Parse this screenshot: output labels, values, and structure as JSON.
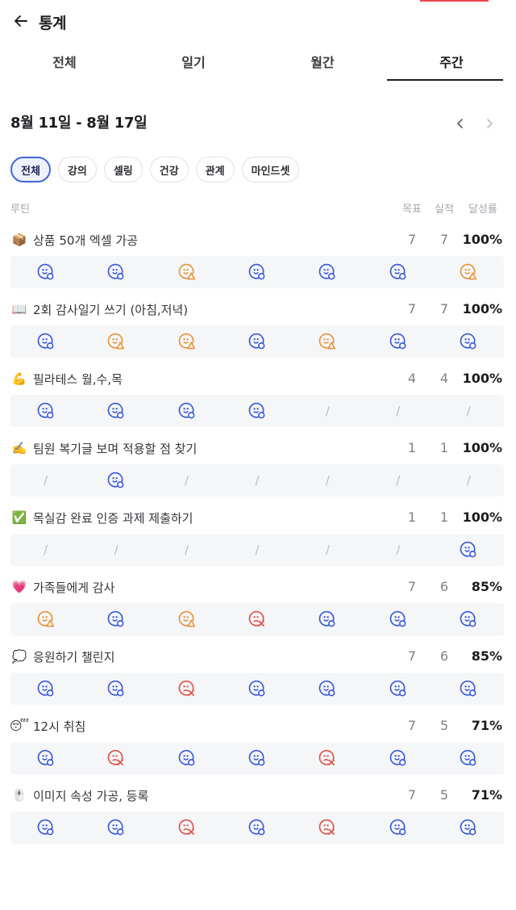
{
  "header": {
    "back_icon": "arrow-left-icon",
    "title": "통계"
  },
  "tabs": [
    {
      "label": "전체",
      "active": false
    },
    {
      "label": "일기",
      "active": false
    },
    {
      "label": "월간",
      "active": false
    },
    {
      "label": "주간",
      "active": true
    }
  ],
  "week": {
    "range_label": "8월 11일 - 8월 17일",
    "prev_icon": "chevron-left-icon",
    "next_icon": "chevron-right-icon"
  },
  "filters": [
    {
      "label": "전체",
      "active": true
    },
    {
      "label": "강의",
      "active": false
    },
    {
      "label": "셀링",
      "active": false
    },
    {
      "label": "건강",
      "active": false
    },
    {
      "label": "관계",
      "active": false
    },
    {
      "label": "마인드셋",
      "active": false
    }
  ],
  "columns": {
    "routine": "루틴",
    "goal": "목표",
    "actual": "실적",
    "rate": "달성률"
  },
  "colors": {
    "success": "#3a5ad9",
    "partial": "#e8933a",
    "fail": "#e0524b",
    "accent": "#4565d9",
    "top_accent": "#e5484d"
  },
  "routines": [
    {
      "icon": "package-emoji-icon",
      "emoji": "📦",
      "name": "상품 50개 엑셀 가공",
      "goal": "7",
      "actual": "7",
      "rate": "100%",
      "days": [
        "success",
        "success",
        "partial",
        "success",
        "success",
        "success",
        "partial"
      ]
    },
    {
      "icon": "open-book-emoji-icon",
      "emoji": "📖",
      "name": "2회 감사일기 쓰기 (아침,저녁)",
      "goal": "7",
      "actual": "7",
      "rate": "100%",
      "days": [
        "success",
        "partial",
        "partial",
        "success",
        "partial",
        "success",
        "success"
      ]
    },
    {
      "icon": "flexed-biceps-emoji-icon",
      "emoji": "💪",
      "name": "필라테스 월,수,목",
      "goal": "4",
      "actual": "4",
      "rate": "100%",
      "days": [
        "success",
        "success",
        "success",
        "success",
        "none",
        "none",
        "none"
      ]
    },
    {
      "icon": "writing-hand-emoji-icon",
      "emoji": "✍️",
      "name": "팀원 복기글 보며 적용할 점 찾기",
      "goal": "1",
      "actual": "1",
      "rate": "100%",
      "days": [
        "none",
        "success",
        "none",
        "none",
        "none",
        "none",
        "none"
      ]
    },
    {
      "icon": "check-mark-emoji-icon",
      "emoji": "✅",
      "name": "목실감 완료 인증 과제 제출하기",
      "goal": "1",
      "actual": "1",
      "rate": "100%",
      "days": [
        "none",
        "none",
        "none",
        "none",
        "none",
        "none",
        "success"
      ]
    },
    {
      "icon": "heart-emoji-icon",
      "emoji": "💗",
      "name": "가족들에게 감사",
      "goal": "7",
      "actual": "6",
      "rate": "85%",
      "days": [
        "partial",
        "success",
        "partial",
        "fail",
        "success",
        "success",
        "success"
      ]
    },
    {
      "icon": "speech-bubble-emoji-icon",
      "emoji": "💭",
      "name": "응원하기 챌린지",
      "goal": "7",
      "actual": "6",
      "rate": "85%",
      "days": [
        "success",
        "success",
        "fail",
        "success",
        "success",
        "success",
        "success"
      ]
    },
    {
      "icon": "sleeping-face-emoji-icon",
      "emoji": "😴",
      "name": "12시 취침",
      "goal": "7",
      "actual": "5",
      "rate": "71%",
      "days": [
        "success",
        "fail",
        "success",
        "success",
        "fail",
        "success",
        "success"
      ]
    },
    {
      "icon": "mouse-emoji-icon",
      "emoji": "🖱️",
      "name": "이미지 속성 가공, 등록",
      "goal": "7",
      "actual": "5",
      "rate": "71%",
      "days": [
        "success",
        "success",
        "fail",
        "success",
        "fail",
        "success",
        "success"
      ]
    }
  ]
}
